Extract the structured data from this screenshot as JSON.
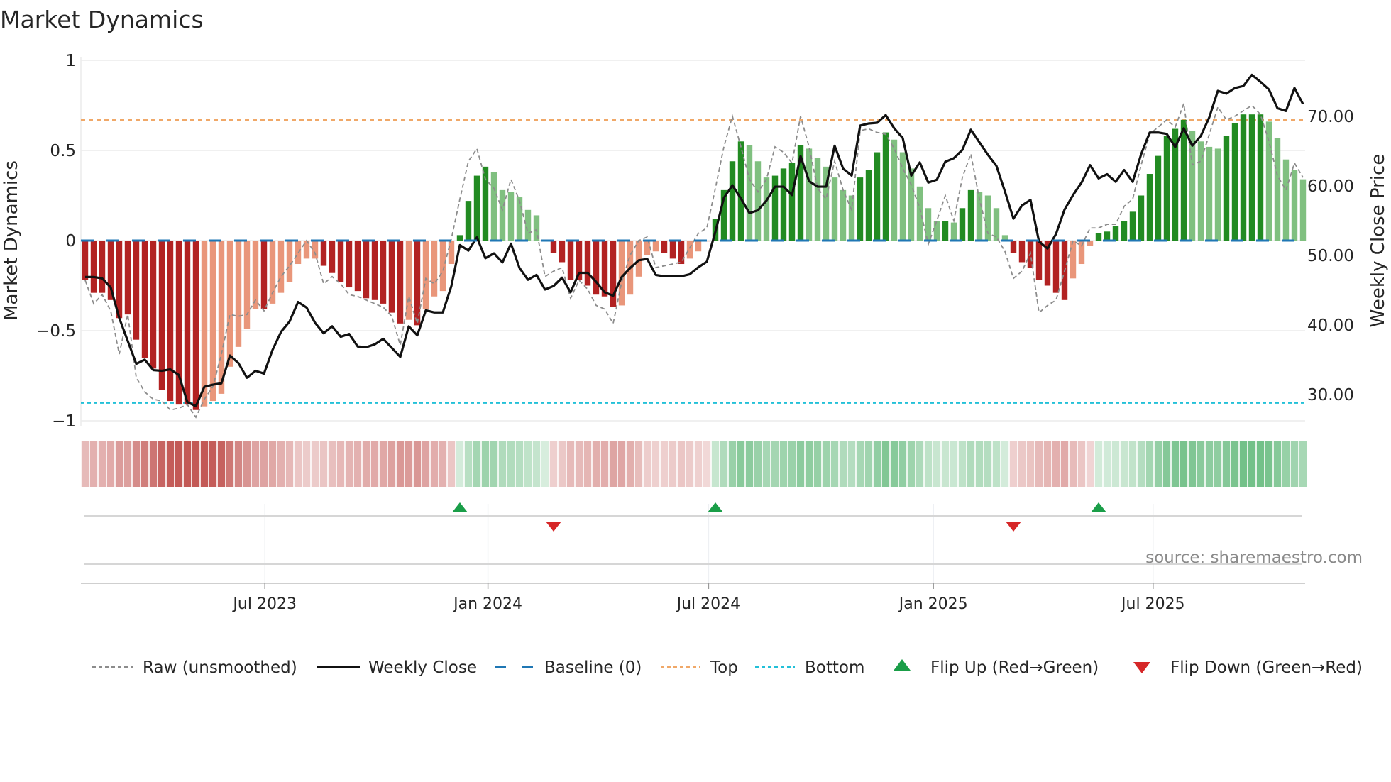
{
  "chart_data": {
    "type": "bar",
    "title": "Market Dynamics",
    "ylabel": "Market Dynamics",
    "y2label": "Weekly Close Price",
    "ylim": [
      -1.0,
      1.0
    ],
    "y2lim": [
      26.2,
      78.1
    ],
    "yticks": [
      {
        "v": 1,
        "label": "1"
      },
      {
        "v": 0.5,
        "label": "0.5"
      },
      {
        "v": 0,
        "label": "0"
      },
      {
        "v": -0.5,
        "label": "−0.5"
      },
      {
        "v": -1,
        "label": "−1"
      }
    ],
    "y2ticks": [
      {
        "v": 70,
        "label": "70.00"
      },
      {
        "v": 60,
        "label": "60.00"
      },
      {
        "v": 50,
        "label": "50.00"
      },
      {
        "v": 40,
        "label": "40.00"
      },
      {
        "v": 30,
        "label": "30.00"
      }
    ],
    "x_unit": "week index",
    "xticks": [
      {
        "week": 21.1,
        "label": "Jul 2023"
      },
      {
        "week": 47.3,
        "label": "Jan 2024"
      },
      {
        "week": 73.2,
        "label": "Jul 2024"
      },
      {
        "week": 99.6,
        "label": "Jan 2025"
      },
      {
        "week": 125.4,
        "label": "Jul 2025"
      }
    ],
    "grid": true,
    "top_level": 0.67,
    "bottom_level": -0.9,
    "baseline": 0,
    "momentum": [
      -0.22,
      -0.29,
      -0.29,
      -0.33,
      -0.43,
      -0.41,
      -0.55,
      -0.65,
      -0.71,
      -0.83,
      -0.89,
      -0.91,
      -0.91,
      -0.94,
      -0.92,
      -0.89,
      -0.85,
      -0.7,
      -0.59,
      -0.49,
      -0.38,
      -0.38,
      -0.35,
      -0.29,
      -0.23,
      -0.13,
      -0.1,
      -0.1,
      -0.14,
      -0.18,
      -0.23,
      -0.26,
      -0.28,
      -0.32,
      -0.33,
      -0.35,
      -0.4,
      -0.46,
      -0.44,
      -0.47,
      -0.38,
      -0.31,
      -0.28,
      -0.13,
      0.03,
      0.22,
      0.36,
      0.41,
      0.38,
      0.28,
      0.27,
      0.24,
      0.17,
      0.14,
      0.005,
      -0.07,
      -0.12,
      -0.22,
      -0.22,
      -0.25,
      -0.3,
      -0.31,
      -0.37,
      -0.36,
      -0.3,
      -0.2,
      -0.08,
      -0.06,
      -0.07,
      -0.1,
      -0.13,
      -0.1,
      -0.06,
      -0.005,
      0.12,
      0.28,
      0.44,
      0.55,
      0.53,
      0.44,
      0.35,
      0.36,
      0.4,
      0.43,
      0.53,
      0.51,
      0.46,
      0.41,
      0.35,
      0.28,
      0.25,
      0.35,
      0.39,
      0.49,
      0.6,
      0.56,
      0.49,
      0.4,
      0.3,
      0.18,
      0.11,
      0.11,
      0.1,
      0.18,
      0.28,
      0.27,
      0.25,
      0.18,
      0.03,
      -0.07,
      -0.12,
      -0.15,
      -0.22,
      -0.25,
      -0.29,
      -0.33,
      -0.21,
      -0.13,
      -0.03,
      0.04,
      0.05,
      0.08,
      0.11,
      0.16,
      0.25,
      0.37,
      0.47,
      0.58,
      0.62,
      0.67,
      0.61,
      0.55,
      0.52,
      0.51,
      0.58,
      0.65,
      0.7,
      0.7,
      0.7,
      0.66,
      0.57,
      0.45,
      0.39,
      0.34
    ],
    "shade": "DDDDDDDDDDDDDDLLLLLLLDLLLLLLDDDDDDDDDDLDLLLLDDDDLLLLLLLDDDDDDDDLLLLLDDDLLLDDDDLLLDDDDLLLLLLDDDDLLLLLLDLDDLLLLDDDDDDDLLLDDDDDDDDDDDLLLLDDDDDLLLLL",
    "raw": [
      -0.22,
      -0.35,
      -0.3,
      -0.39,
      -0.63,
      -0.41,
      -0.76,
      -0.84,
      -0.88,
      -0.89,
      -0.94,
      -0.93,
      -0.91,
      -0.98,
      -0.88,
      -0.81,
      -0.63,
      -0.41,
      -0.42,
      -0.41,
      -0.33,
      -0.39,
      -0.29,
      -0.2,
      -0.14,
      -0.07,
      0.0,
      -0.07,
      -0.24,
      -0.2,
      -0.24,
      -0.3,
      -0.31,
      -0.33,
      -0.35,
      -0.37,
      -0.42,
      -0.58,
      -0.31,
      -0.46,
      -0.21,
      -0.24,
      -0.17,
      0.01,
      0.23,
      0.44,
      0.51,
      0.34,
      0.29,
      0.17,
      0.34,
      0.22,
      0.04,
      0.06,
      -0.2,
      -0.17,
      -0.15,
      -0.32,
      -0.22,
      -0.27,
      -0.36,
      -0.38,
      -0.46,
      -0.23,
      -0.08,
      0.0,
      0.02,
      -0.15,
      -0.14,
      -0.13,
      -0.12,
      -0.04,
      0.04,
      0.07,
      0.29,
      0.52,
      0.69,
      0.52,
      0.34,
      0.27,
      0.34,
      0.52,
      0.49,
      0.43,
      0.69,
      0.52,
      0.29,
      0.23,
      0.44,
      0.28,
      0.17,
      0.61,
      0.62,
      0.6,
      0.59,
      0.51,
      0.4,
      0.31,
      0.18,
      -0.02,
      0.11,
      0.25,
      0.11,
      0.35,
      0.48,
      0.23,
      0.04,
      0.02,
      -0.06,
      -0.21,
      -0.17,
      -0.07,
      -0.4,
      -0.36,
      -0.33,
      -0.17,
      0.0,
      -0.03,
      0.07,
      0.07,
      0.09,
      0.09,
      0.19,
      0.23,
      0.42,
      0.59,
      0.63,
      0.67,
      0.63,
      0.76,
      0.42,
      0.44,
      0.59,
      0.74,
      0.67,
      0.69,
      0.72,
      0.75,
      0.7,
      0.55,
      0.36,
      0.28,
      0.43,
      0.35
    ],
    "weekly_close": [
      46.9,
      46.9,
      46.7,
      45.4,
      41.0,
      37.7,
      34.4,
      35.0,
      33.5,
      33.4,
      33.6,
      32.8,
      28.9,
      28.3,
      31.1,
      31.4,
      31.6,
      35.6,
      34.5,
      32.4,
      33.4,
      33.0,
      36.4,
      39.0,
      40.5,
      43.3,
      42.5,
      40.3,
      38.8,
      39.8,
      38.3,
      38.7,
      36.9,
      36.8,
      37.2,
      38.0,
      36.7,
      35.4,
      39.8,
      38.5,
      42.1,
      41.8,
      41.8,
      45.6,
      51.5,
      50.7,
      52.6,
      49.6,
      50.3,
      49.0,
      51.7,
      48.2,
      46.5,
      47.2,
      45.1,
      45.6,
      46.8,
      44.7,
      47.5,
      47.5,
      46.2,
      44.7,
      44.2,
      46.9,
      48.2,
      49.3,
      49.5,
      47.2,
      47.0,
      47.0,
      47.0,
      47.3,
      48.3,
      49.1,
      53.4,
      58.3,
      60.1,
      58.2,
      56.1,
      56.5,
      57.9,
      59.9,
      59.9,
      58.7,
      64.3,
      60.7,
      59.9,
      59.9,
      65.8,
      62.5,
      61.5,
      68.7,
      69.0,
      69.1,
      70.2,
      68.3,
      66.9,
      61.5,
      63.4,
      60.5,
      60.9,
      63.5,
      64.0,
      65.2,
      68.1,
      66.3,
      64.5,
      62.9,
      59.2,
      55.3,
      57.2,
      58.0,
      52.0,
      51.0,
      53.1,
      56.6,
      58.7,
      60.5,
      63.0,
      61.1,
      61.7,
      60.6,
      62.3,
      60.6,
      64.6,
      67.7,
      67.7,
      67.5,
      65.6,
      68.3,
      65.8,
      67.2,
      69.9,
      73.7,
      73.3,
      74.1,
      74.4,
      76.0,
      75.0,
      73.9,
      71.2,
      70.8,
      74.1,
      71.8
    ],
    "flip_up_weeks": [
      44,
      74,
      119
    ],
    "flip_down_weeks": [
      55,
      109
    ],
    "colors": {
      "pos_strong": "#228b22",
      "pos_weak": "#80c080",
      "neg_strong": "#b22222",
      "neg_weak": "#e9967a",
      "raw": "#8c8c8c",
      "close": "#111111",
      "baseline": "#1f77b4",
      "top": "#f0a868",
      "bottom": "#22c0d8",
      "flip_up": "#1a9e48",
      "flip_down": "#d62728",
      "heat_pos": "#4caf68",
      "heat_neg": "#c0504d"
    },
    "legend": [
      {
        "key": "raw",
        "label": "Raw (unsmoothed)"
      },
      {
        "key": "close",
        "label": "Weekly Close"
      },
      {
        "key": "baseline",
        "label": "Baseline (0)"
      },
      {
        "key": "top",
        "label": "Top"
      },
      {
        "key": "bottom",
        "label": "Bottom"
      },
      {
        "key": "flip_up",
        "label": "Flip Up (Red→Green)"
      },
      {
        "key": "flip_down",
        "label": "Flip Down (Green→Red)"
      }
    ],
    "legend_position": "bottom",
    "source": "source: sharemaestro.com"
  }
}
